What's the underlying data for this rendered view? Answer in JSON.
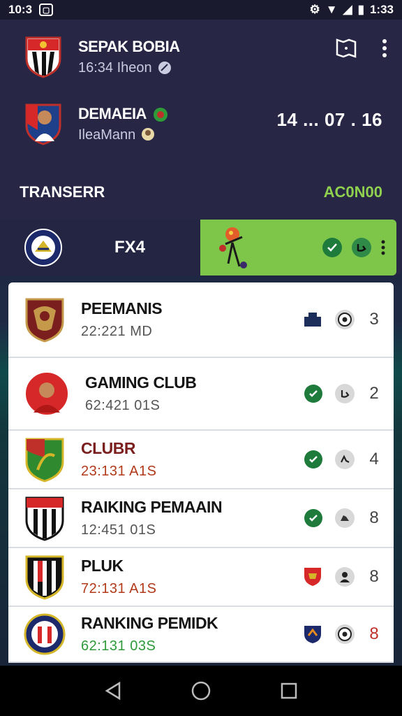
{
  "status_bar": {
    "time": "10:3",
    "battery_time": "1:33"
  },
  "header": {
    "team1": {
      "name": "SEPAK BOBIA",
      "sub": "16:34 Iheon"
    },
    "team2": {
      "name": "DEMAEIA",
      "sub": "IleaMann"
    },
    "score": "14 ... 07 . 16",
    "transfer_label": "TRANSERR",
    "transfer_value": "AC0N00",
    "fx_label": "FX4"
  },
  "list": [
    {
      "name": "PEEMANIS",
      "sub": "22:221 MD",
      "rank": "3",
      "sub_color": "#555555",
      "rank_color": "#444444"
    },
    {
      "name": "GAMING CLUB",
      "sub": "62:421 01S",
      "rank": "2",
      "sub_color": "#555555",
      "rank_color": "#444444"
    },
    {
      "name": "CLUBR",
      "sub": "23:131 A1S",
      "rank": "4",
      "sub_color": "#b03a1a",
      "rank_color": "#444444"
    },
    {
      "name": "RAIKING PEMAAIN",
      "sub": "12:451 01S",
      "rank": "8",
      "sub_color": "#555555",
      "rank_color": "#444444"
    },
    {
      "name": "PLUK",
      "sub": "72:131 A1S",
      "rank": "8",
      "sub_color": "#b03a1a",
      "rank_color": "#444444"
    },
    {
      "name": "RANKING PEMIDK",
      "sub": "62:131 03S",
      "rank": "8",
      "sub_color": "#2e9a3a",
      "rank_color": "#c0302a"
    }
  ],
  "colors": {
    "accent_green": "#7ec64a",
    "header_bg": "#272645",
    "check_green": "#1e7b3c"
  }
}
